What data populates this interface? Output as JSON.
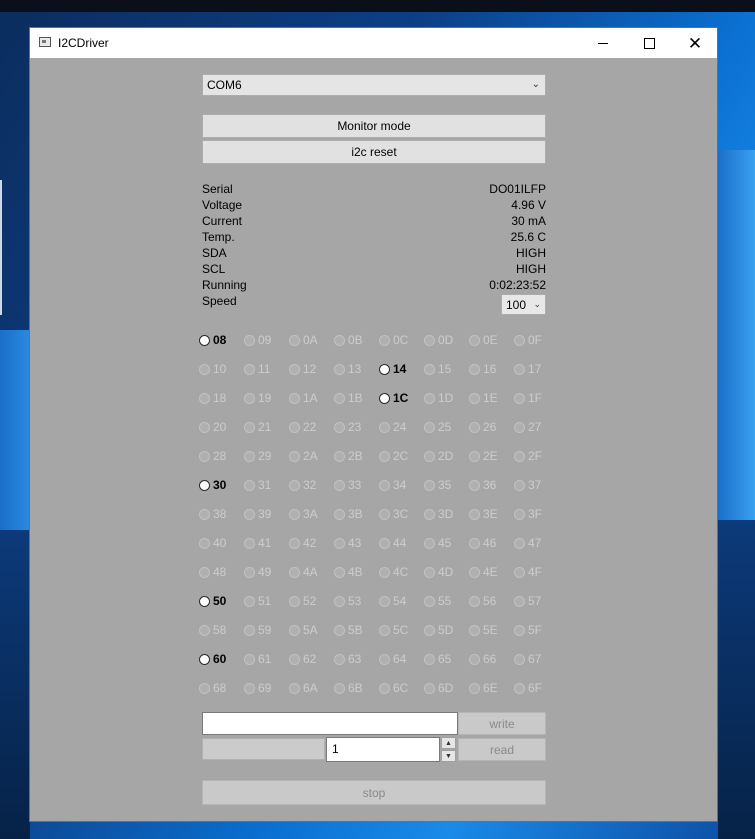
{
  "window": {
    "title": "I2CDriver"
  },
  "port": {
    "selected": "COM6"
  },
  "buttons": {
    "monitor": "Monitor mode",
    "reset": "i2c reset",
    "write": "write",
    "read": "read",
    "stop": "stop"
  },
  "info": [
    {
      "label": "Serial",
      "value": "DO01ILFP"
    },
    {
      "label": "Voltage",
      "value": "4.96 V"
    },
    {
      "label": "Current",
      "value": "30 mA"
    },
    {
      "label": "Temp.",
      "value": "25.6 C"
    },
    {
      "label": "SDA",
      "value": "HIGH"
    },
    {
      "label": "SCL",
      "value": "HIGH"
    },
    {
      "label": "Running",
      "value": "0:02:23:52"
    },
    {
      "label": "Speed",
      "value": ""
    }
  ],
  "speed": {
    "selected": "100"
  },
  "addresses": [
    [
      "08",
      "09",
      "0A",
      "0B",
      "0C",
      "0D",
      "0E",
      "0F"
    ],
    [
      "10",
      "11",
      "12",
      "13",
      "14",
      "15",
      "16",
      "17"
    ],
    [
      "18",
      "19",
      "1A",
      "1B",
      "1C",
      "1D",
      "1E",
      "1F"
    ],
    [
      "20",
      "21",
      "22",
      "23",
      "24",
      "25",
      "26",
      "27"
    ],
    [
      "28",
      "29",
      "2A",
      "2B",
      "2C",
      "2D",
      "2E",
      "2F"
    ],
    [
      "30",
      "31",
      "32",
      "33",
      "34",
      "35",
      "36",
      "37"
    ],
    [
      "38",
      "39",
      "3A",
      "3B",
      "3C",
      "3D",
      "3E",
      "3F"
    ],
    [
      "40",
      "41",
      "42",
      "43",
      "44",
      "45",
      "46",
      "47"
    ],
    [
      "48",
      "49",
      "4A",
      "4B",
      "4C",
      "4D",
      "4E",
      "4F"
    ],
    [
      "50",
      "51",
      "52",
      "53",
      "54",
      "55",
      "56",
      "57"
    ],
    [
      "58",
      "59",
      "5A",
      "5B",
      "5C",
      "5D",
      "5E",
      "5F"
    ],
    [
      "60",
      "61",
      "62",
      "63",
      "64",
      "65",
      "66",
      "67"
    ],
    [
      "68",
      "69",
      "6A",
      "6B",
      "6C",
      "6D",
      "6E",
      "6F"
    ]
  ],
  "active_addresses": [
    "08",
    "14",
    "1C",
    "30",
    "50",
    "60"
  ],
  "write_field": {
    "value": ""
  },
  "read_count": {
    "value": "1"
  }
}
